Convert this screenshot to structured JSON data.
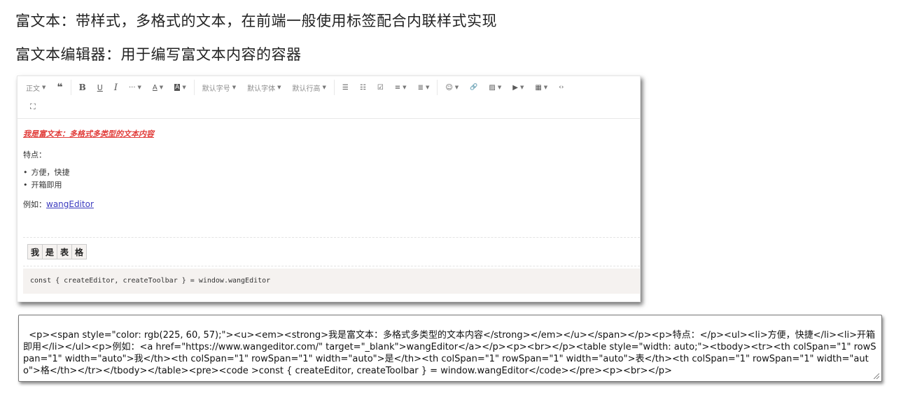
{
  "headings": {
    "rich_text": "富文本：带样式，多格式的文本，在前端一般使用标签配合内联样式实现",
    "editor": "富文本编辑器：用于编写富文本内容的容器"
  },
  "toolbar": {
    "paragraph": "正文",
    "quote": "❝",
    "bold": "B",
    "underline": "U",
    "italic": "I",
    "more": "···",
    "font_color": "A",
    "bg_color": "A",
    "font_size": "默认字号",
    "font_family": "默认字体",
    "line_height": "默认行高",
    "bulleted_list": "☰",
    "numbered_list": "☷",
    "todo": "☑",
    "justify": "≡",
    "indent": "≣",
    "emotion": "☺",
    "link": "🔗",
    "image": "▨",
    "video": "▶",
    "table": "▦",
    "code": "‹›",
    "fullscreen": "⛶"
  },
  "content": {
    "title": "我是富文本：多格式多类型的文本内容",
    "features_label": "特点：",
    "features": [
      "方便，快捷",
      "开箱即用"
    ],
    "example_label": "例如：",
    "example_link": "wangEditor",
    "table_cells": [
      "我",
      "是",
      "表",
      "格"
    ],
    "code": "const { createEditor, createToolbar } = window.wangEditor",
    "title_color": "#e13c39"
  },
  "html_output": "<p><span style=\"color: rgb(225, 60, 57);\"><u><em><strong>我是富文本：多格式多类型的文本内容</strong></em></u></span></p><p>特点：</p><ul><li>方便，快捷</li><li>开箱即用</li></ul><p>例如：<a href=\"https://www.wangeditor.com/\" target=\"_blank\">wangEditor</a></p><p><br></p><table style=\"width: auto;\"><tbody><tr><th colSpan=\"1\" rowSpan=\"1\" width=\"auto\">我</th><th colSpan=\"1\" rowSpan=\"1\" width=\"auto\">是</th><th colSpan=\"1\" rowSpan=\"1\" width=\"auto\">表</th><th colSpan=\"1\" rowSpan=\"1\" width=\"auto\">格</th></tr></tbody></table><pre><code >const { createEditor, createToolbar } = window.wangEditor</code></pre><p><br></p>"
}
